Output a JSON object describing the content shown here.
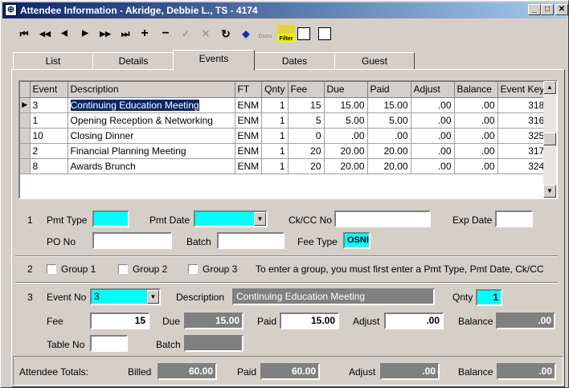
{
  "window": {
    "title": "Attendee Information - Akridge, Debbie L., TS - 4174",
    "min": "_",
    "max": "□",
    "close": "✕"
  },
  "toolbar": {
    "first": "⏮",
    "prev_page": "◀◀",
    "prev": "◀",
    "next": "▶",
    "next_page": "▶▶",
    "last": "⏭",
    "add": "+",
    "delete": "−",
    "post": "✓",
    "cancel": "✕",
    "refresh": "↻",
    "dues": "Dues",
    "filter": "Filter"
  },
  "tabs": [
    "List",
    "Details",
    "Events",
    "Dates",
    "Guest"
  ],
  "grid": {
    "columns": [
      "Event",
      "Description",
      "FT",
      "Qnty",
      "Fee",
      "Due",
      "Paid",
      "Adjust",
      "Balance",
      "Event Key"
    ],
    "rows": [
      [
        "3",
        "Continuing Education Meeting",
        "ENM",
        "1",
        "15",
        "15.00",
        "15.00",
        ".00",
        ".00",
        "318"
      ],
      [
        "1",
        "Opening Reception & Networking",
        "ENM",
        "1",
        "5",
        "5.00",
        "5.00",
        ".00",
        ".00",
        "316"
      ],
      [
        "10",
        "Closing Dinner",
        "ENM",
        "1",
        "0",
        ".00",
        ".00",
        ".00",
        ".00",
        "325"
      ],
      [
        "2",
        "Financial Planning Meeting",
        "ENM",
        "1",
        "20",
        "20.00",
        "20.00",
        ".00",
        ".00",
        "317"
      ],
      [
        "8",
        "Awards Brunch",
        "ENM",
        "1",
        "20",
        "20.00",
        "20.00",
        ".00",
        ".00",
        "324"
      ]
    ]
  },
  "section1": {
    "num": "1",
    "pmt_type_label": "Pmt Type",
    "pmt_type": "",
    "pmt_date_label": "Pmt Date",
    "pmt_date": "",
    "ckcc_label": "Ck/CC No",
    "ckcc": "",
    "exp_label": "Exp Date",
    "exp": "",
    "po_label": "PO No",
    "po": "",
    "batch_label": "Batch",
    "batch": "",
    "fee_type_label": "Fee Type",
    "fee_type": "OSNI"
  },
  "section2": {
    "num": "2",
    "group1": "Group 1",
    "group2": "Group 2",
    "group3": "Group 3",
    "hint": "To enter a group, you must first enter a Pmt Type, Pmt Date, Ck/CC"
  },
  "section3": {
    "num": "3",
    "event_no_label": "Event No",
    "event_no": "3",
    "desc_label": "Description",
    "desc": "Continuing Education Meeting",
    "qnty_label": "Qnty",
    "qnty": "1",
    "fee_label": "Fee",
    "fee": "15",
    "due_label": "Due",
    "due": "15.00",
    "paid_label": "Paid",
    "paid": "15.00",
    "adjust_label": "Adjust",
    "adjust": ".00",
    "balance_label": "Balance",
    "balance": ".00",
    "table_label": "Table No",
    "table": "",
    "batch_label": "Batch",
    "batch": ""
  },
  "totals": {
    "label": "Attendee Totals:",
    "billed_label": "Billed",
    "billed": "60.00",
    "paid_label": "Paid",
    "paid": "60.00",
    "adjust_label": "Adjust",
    "adjust": ".00",
    "balance_label": "Balance",
    "balance": ".00"
  }
}
